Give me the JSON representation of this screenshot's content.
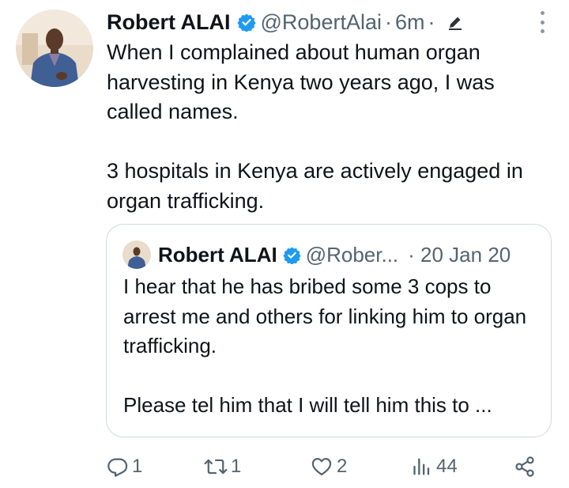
{
  "tweet": {
    "author_name": "Robert ALAI",
    "handle": "@RobertAlai",
    "separator": "·",
    "time": "6m",
    "separator2": "·",
    "text_lines": [
      "When I complained about human organ harvesting in Kenya two years ago, I was called names.",
      "3 hospitals in Kenya are actively engaged in organ trafficking."
    ]
  },
  "quote": {
    "author_name": "Robert ALAI",
    "handle": "@Rober...",
    "date": "· 20 Jan 20",
    "text_lines": [
      "I hear that he has bribed some 3 cops to arrest me and others for linking him to organ trafficking.",
      "Please tel him that I will tell him this to ..."
    ]
  },
  "actions": {
    "replies": "1",
    "reposts": "1",
    "likes": "2",
    "views": "44"
  },
  "icons": {
    "verified": "verified-badge-icon",
    "edit": "pencil-icon",
    "more": "more-vertical-icon",
    "reply": "reply-icon",
    "repost": "repost-icon",
    "like": "heart-icon",
    "views": "views-icon",
    "share": "share-icon"
  },
  "colors": {
    "verified": "#1d9bf0",
    "secondary_text": "#536471",
    "primary_text": "#0f1419",
    "border": "#cfd9de"
  }
}
